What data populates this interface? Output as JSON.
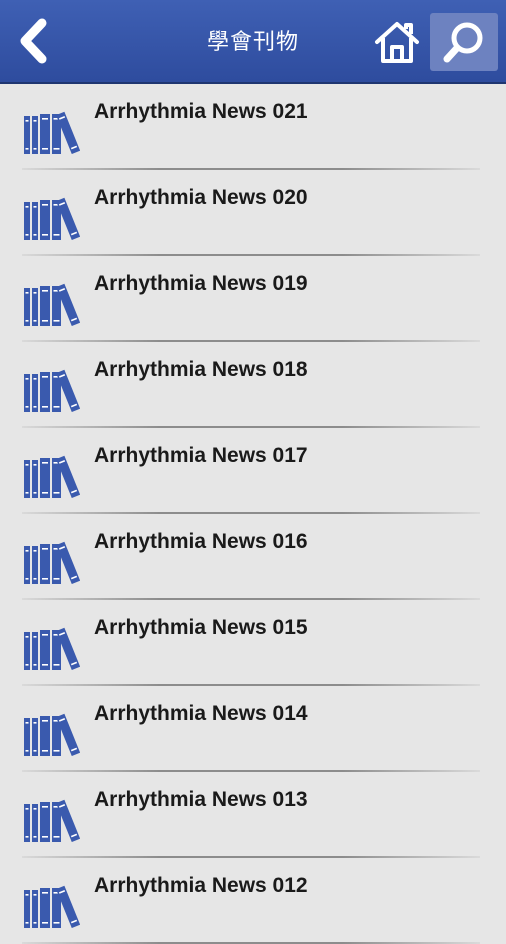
{
  "header": {
    "title": "學會刊物",
    "back_icon": "chevron-left-icon",
    "home_icon": "home-icon",
    "search_icon": "search-icon",
    "bar_color": "#3a5aae",
    "search_active_color": "#6d82c0"
  },
  "list": {
    "icon": "books-icon",
    "icon_color": "#3a5aae",
    "items": [
      {
        "label": "Arrhythmia News 021"
      },
      {
        "label": "Arrhythmia News 020"
      },
      {
        "label": "Arrhythmia News 019"
      },
      {
        "label": "Arrhythmia News 018"
      },
      {
        "label": "Arrhythmia News 017"
      },
      {
        "label": "Arrhythmia News 016"
      },
      {
        "label": "Arrhythmia News 015"
      },
      {
        "label": "Arrhythmia News 014"
      },
      {
        "label": "Arrhythmia News 013"
      },
      {
        "label": "Arrhythmia News 012"
      }
    ]
  }
}
